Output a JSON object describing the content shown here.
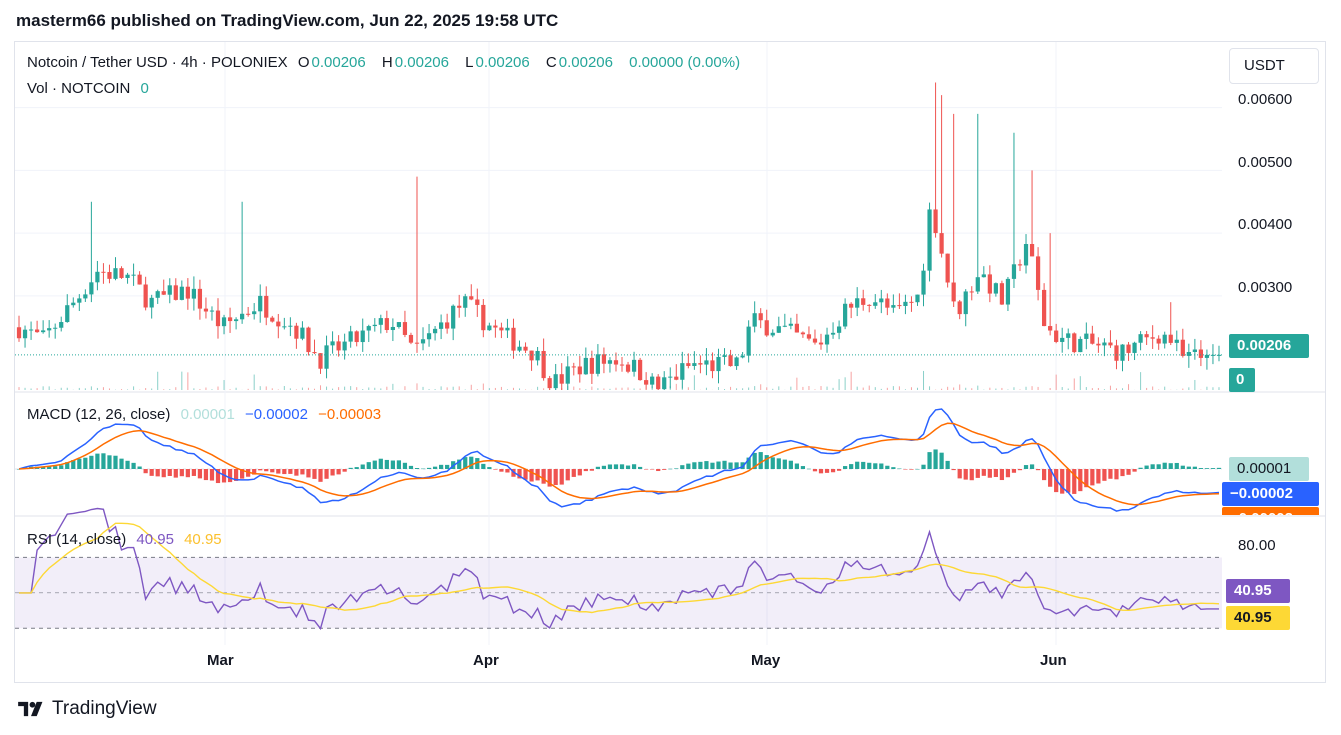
{
  "header": {
    "text": "masterm66 published on TradingView.com, Jun 22, 2025 19:58 UTC"
  },
  "symbol": {
    "title": "Notcoin / Tether USD · 4h · POLONIEX",
    "o_label": "O",
    "o": "0.00206",
    "h_label": "H",
    "h": "0.00206",
    "l_label": "L",
    "l": "0.00206",
    "c_label": "C",
    "c": "0.00206",
    "change": "0.00000 (0.00%)",
    "vol_label": "Vol · NOTCOIN",
    "vol_value": "0"
  },
  "currency_button": "USDT",
  "price_ticks": [
    "0.00600",
    "0.00500",
    "0.00400",
    "0.00300"
  ],
  "badges": {
    "price": "0.00206",
    "volume": "0",
    "macd_hist": "0.00001",
    "macd_line": "−0.00002",
    "macd_signal": "−0.00003",
    "rsi": "40.95",
    "rsi_ma": "40.95"
  },
  "macd_legend": {
    "title": "MACD (12, 26, close)",
    "hist": "0.00001",
    "macd": "−0.00002",
    "signal": "−0.00003"
  },
  "rsi_legend": {
    "title": "RSI (14, close)",
    "rsi": "40.95",
    "ma": "40.95"
  },
  "rsi_ticks": [
    "80.00"
  ],
  "x_ticks": [
    "Mar",
    "Apr",
    "May",
    "Jun"
  ],
  "footer": {
    "brand": "TradingView"
  },
  "colors": {
    "up": "#26a69a",
    "down": "#ef5350",
    "macd": "#2962ff",
    "signal": "#ff6d00",
    "rsi": "#7e57c2",
    "rsi_ma": "#fdd835",
    "grid": "#f0f3fa",
    "axis_text": "#131722"
  },
  "chart_data": [
    {
      "type": "candlestick",
      "symbol": "NOTUSDT",
      "exchange": "POLONIEX",
      "interval": "4h",
      "ylim": [
        0.0015,
        0.0066
      ],
      "y_ticks": [
        0.003,
        0.004,
        0.005,
        0.006
      ],
      "x_ticks": [
        "Mar",
        "Apr",
        "May",
        "Jun"
      ],
      "last_price": 0.00206,
      "anchors": [
        {
          "t": 0,
          "v": 0.0025
        },
        {
          "t": 0.02,
          "v": 0.0023
        },
        {
          "t": 0.05,
          "v": 0.003
        },
        {
          "t": 0.065,
          "v": 0.0034
        },
        {
          "t": 0.09,
          "v": 0.0033
        },
        {
          "t": 0.11,
          "v": 0.0029
        },
        {
          "t": 0.14,
          "v": 0.0031
        },
        {
          "t": 0.17,
          "v": 0.0025
        },
        {
          "t": 0.2,
          "v": 0.0029
        },
        {
          "t": 0.23,
          "v": 0.0025
        },
        {
          "t": 0.25,
          "v": 0.002
        },
        {
          "t": 0.28,
          "v": 0.0023
        },
        {
          "t": 0.31,
          "v": 0.0026
        },
        {
          "t": 0.33,
          "v": 0.0021
        },
        {
          "t": 0.37,
          "v": 0.0029
        },
        {
          "t": 0.4,
          "v": 0.0024
        },
        {
          "t": 0.43,
          "v": 0.0021
        },
        {
          "t": 0.445,
          "v": 0.0016
        },
        {
          "t": 0.47,
          "v": 0.0019
        },
        {
          "t": 0.5,
          "v": 0.002
        },
        {
          "t": 0.525,
          "v": 0.0017
        },
        {
          "t": 0.53,
          "v": 0.0015
        },
        {
          "t": 0.56,
          "v": 0.0019
        },
        {
          "t": 0.6,
          "v": 0.0019
        },
        {
          "t": 0.61,
          "v": 0.0026
        },
        {
          "t": 0.63,
          "v": 0.0025
        },
        {
          "t": 0.665,
          "v": 0.0022
        },
        {
          "t": 0.69,
          "v": 0.0028
        },
        {
          "t": 0.71,
          "v": 0.003
        },
        {
          "t": 0.73,
          "v": 0.0027
        },
        {
          "t": 0.75,
          "v": 0.003
        },
        {
          "t": 0.76,
          "v": 0.0045
        },
        {
          "t": 0.78,
          "v": 0.0027
        },
        {
          "t": 0.8,
          "v": 0.0034
        },
        {
          "t": 0.82,
          "v": 0.0029
        },
        {
          "t": 0.84,
          "v": 0.0039
        },
        {
          "t": 0.855,
          "v": 0.0025
        },
        {
          "t": 0.87,
          "v": 0.0023
        },
        {
          "t": 0.9,
          "v": 0.0022
        },
        {
          "t": 0.92,
          "v": 0.0021
        },
        {
          "t": 0.95,
          "v": 0.0024
        },
        {
          "t": 0.96,
          "v": 0.0023
        },
        {
          "t": 0.97,
          "v": 0.002
        },
        {
          "t": 1.0,
          "v": 0.00206
        }
      ],
      "spikes": [
        {
          "t": 0.062,
          "high": 0.0045
        },
        {
          "t": 0.185,
          "high": 0.0045
        },
        {
          "t": 0.33,
          "high": 0.0049
        },
        {
          "t": 0.765,
          "high": 0.0064
        },
        {
          "t": 0.77,
          "high": 0.0062
        },
        {
          "t": 0.78,
          "high": 0.0059
        },
        {
          "t": 0.8,
          "high": 0.0059
        },
        {
          "t": 0.83,
          "high": 0.0056
        },
        {
          "t": 0.845,
          "high": 0.005
        },
        {
          "t": 0.86,
          "high": 0.004
        },
        {
          "t": 0.96,
          "high": 0.0029
        }
      ]
    },
    {
      "type": "histogram+line",
      "title": "MACD (12, 26, close)",
      "series": [
        {
          "name": "Histogram",
          "last": 1e-05
        },
        {
          "name": "MACD",
          "last": -2e-05
        },
        {
          "name": "Signal",
          "last": -3e-05
        }
      ]
    },
    {
      "type": "line",
      "title": "RSI (14, close)",
      "ylim": [
        20,
        90
      ],
      "bands": [
        70,
        50,
        30
      ],
      "y_ticks": [
        80
      ],
      "series": [
        {
          "name": "RSI",
          "last": 40.95
        },
        {
          "name": "RSI-based MA",
          "last": 40.95
        }
      ]
    }
  ]
}
